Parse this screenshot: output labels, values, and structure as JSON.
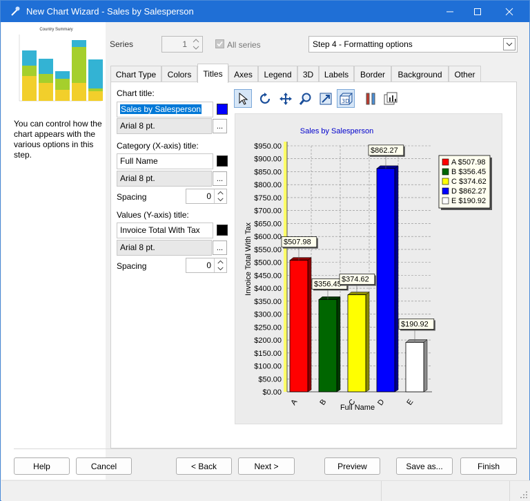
{
  "window": {
    "title": "New Chart Wizard - Sales by Salesperson"
  },
  "sidebar": {
    "thumbnail_title": "Country Summary",
    "help_text": "You can control how the chart appears with the various options in this step."
  },
  "top": {
    "series_label": "Series",
    "series_value": "1",
    "all_series_label": "All series",
    "step_selected": "Step 4 - Formatting options"
  },
  "tabs": [
    "Chart Type",
    "Colors",
    "Titles",
    "Axes",
    "Legend",
    "3D",
    "Labels",
    "Border",
    "Background",
    "Other"
  ],
  "titles_panel": {
    "chart_title_label": "Chart title:",
    "chart_title_value": "Sales by Salesperson",
    "chart_title_font": "Arial 8 pt.",
    "chart_title_color": "#0000ff",
    "category_title_label": "Category (X-axis) title:",
    "category_title_value": "Full Name",
    "category_title_font": "Arial 8 pt.",
    "category_title_color": "#000000",
    "category_spacing_label": "Spacing",
    "category_spacing_value": "0",
    "values_title_label": "Values (Y-axis) title:",
    "values_title_value": "Invoice Total With Tax",
    "values_title_font": "Arial 8 pt.",
    "values_title_color": "#000000",
    "values_spacing_label": "Spacing",
    "values_spacing_value": "0",
    "font_button": "..."
  },
  "chart_data": {
    "type": "bar",
    "title": "Sales by Salesperson",
    "xlabel": "Full Name",
    "ylabel": "Invoice Total With Tax",
    "categories": [
      "A",
      "B",
      "C",
      "D",
      "E"
    ],
    "values": [
      507.98,
      356.45,
      374.62,
      862.27,
      190.92
    ],
    "data_labels": [
      "$507.98",
      "$356.45",
      "$374.62",
      "$862.27",
      "$190.92"
    ],
    "colors": [
      "#ff0000",
      "#006600",
      "#ffff00",
      "#0000ff",
      "#ffffff"
    ],
    "ylim": [
      0,
      950
    ],
    "ytick_step": 50,
    "yticks": [
      "$0.00",
      "$50.00",
      "$100.00",
      "$150.00",
      "$200.00",
      "$250.00",
      "$300.00",
      "$350.00",
      "$400.00",
      "$450.00",
      "$500.00",
      "$550.00",
      "$600.00",
      "$650.00",
      "$700.00",
      "$750.00",
      "$800.00",
      "$850.00",
      "$900.00",
      "$950.00"
    ],
    "legend": [
      "A $507.98",
      "B $356.45",
      "C $374.62",
      "D $862.27",
      "E $190.92"
    ],
    "legend_position": "right",
    "grid": true
  },
  "buttons": {
    "help": "Help",
    "cancel": "Cancel",
    "back": "< Back",
    "next": "Next >",
    "preview": "Preview",
    "save_as": "Save as...",
    "finish": "Finish"
  }
}
